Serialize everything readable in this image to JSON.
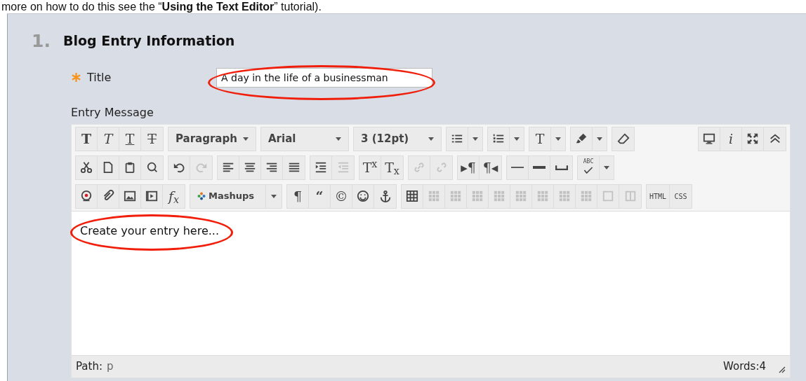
{
  "intro_text": "more on how to do this see the “**Using the Text Editor**” tutorial).",
  "section": {
    "number": "1.",
    "title": "Blog Entry Information"
  },
  "title_field": {
    "label": "Title",
    "required": true,
    "value": "A day in the life of a businessman",
    "circled": true
  },
  "message_label": "Entry Message",
  "toolbar": [
    {
      "groups": [
        {
          "items": [
            {
              "kind": "bold",
              "label": "T",
              "disabled": false
            },
            {
              "kind": "italic",
              "label": "T",
              "disabled": false
            },
            {
              "kind": "underline",
              "label": "T",
              "disabled": false
            },
            {
              "kind": "strike",
              "label": "T",
              "disabled": false
            }
          ]
        },
        {
          "items": [
            {
              "kind": "select",
              "value": "Paragraph",
              "disabled": false
            }
          ]
        },
        {
          "items": [
            {
              "kind": "select",
              "value": "Arial",
              "disabled": false
            }
          ]
        },
        {
          "items": [
            {
              "kind": "select",
              "value": "3 (12pt)",
              "disabled": false
            }
          ]
        },
        {
          "items": [
            {
              "kind": "iconmenu",
              "disabled": false
            }
          ]
        },
        {
          "items": [
            {
              "kind": "iconmenu",
              "disabled": false
            }
          ]
        },
        {
          "items": [
            {
              "kind": "textmenu",
              "label": "T",
              "disabled": false
            }
          ]
        },
        {
          "items": [
            {
              "kind": "iconmenu",
              "disabled": false
            }
          ]
        },
        {
          "items": [
            {
              "kind": "icon",
              "disabled": false
            }
          ]
        }
      ],
      "end_groups": [
        {
          "items": [
            {
              "kind": "icon",
              "disabled": false
            },
            {
              "kind": "italic",
              "label": "i",
              "disabled": false
            },
            {
              "kind": "icon",
              "disabled": false
            },
            {
              "kind": "icon",
              "disabled": false
            }
          ]
        }
      ]
    },
    {
      "groups": [
        {
          "items": [
            {
              "kind": "icon",
              "disabled": false
            },
            {
              "kind": "icon",
              "disabled": false
            },
            {
              "kind": "icon",
              "disabled": false
            },
            {
              "kind": "icon",
              "disabled": false
            }
          ]
        },
        {
          "items": [
            {
              "kind": "icon",
              "disabled": false
            },
            {
              "kind": "icon",
              "disabled": true
            }
          ]
        },
        {
          "items": [
            {
              "kind": "icon",
              "disabled": false
            },
            {
              "kind": "icon",
              "disabled": false
            },
            {
              "kind": "icon",
              "disabled": false
            },
            {
              "kind": "icon",
              "disabled": false
            }
          ]
        },
        {
          "items": [
            {
              "kind": "icon",
              "disabled": false
            },
            {
              "kind": "icon",
              "disabled": true
            }
          ]
        },
        {
          "items": [
            {
              "kind": "text",
              "label": "T$^{x}$",
              "disabled": false
            },
            {
              "kind": "text",
              "label": "T$_{x}$",
              "disabled": false
            }
          ]
        },
        {
          "items": [
            {
              "kind": "icon",
              "disabled": true
            },
            {
              "kind": "icon",
              "disabled": true
            }
          ]
        },
        {
          "items": [
            {
              "kind": "text",
              "label": "▸¶",
              "disabled": false
            },
            {
              "kind": "text",
              "label": "¶◂",
              "disabled": false
            }
          ]
        },
        {
          "items": [
            {
              "kind": "icon",
              "disabled": false
            },
            {
              "kind": "icon",
              "disabled": false
            },
            {
              "kind": "icon",
              "disabled": false
            }
          ]
        },
        {
          "items": [
            {
              "kind": "badgemenu",
              "label": "ABC",
              "disabled": false
            }
          ]
        }
      ]
    },
    {
      "groups": [
        {
          "items": [
            {
              "kind": "icon",
              "disabled": false
            },
            {
              "kind": "icon",
              "disabled": false
            },
            {
              "kind": "icon",
              "disabled": false
            },
            {
              "kind": "icon",
              "disabled": false
            },
            {
              "kind": "italic",
              "label": "f$_{x}$",
              "disabled": false
            }
          ]
        },
        {
          "items": [
            {
              "kind": "menu",
              "value": "Mashups",
              "disabled": false
            }
          ]
        },
        {
          "items": [
            {
              "kind": "text",
              "label": "¶",
              "disabled": false
            },
            {
              "kind": "bold",
              "label": "“",
              "disabled": false
            },
            {
              "kind": "text",
              "label": "©",
              "disabled": false
            },
            {
              "kind": "icon",
              "disabled": false
            },
            {
              "kind": "icon",
              "disabled": false
            }
          ]
        },
        {
          "items": [
            {
              "kind": "icon",
              "disabled": false
            },
            {
              "kind": "icon",
              "disabled": true
            },
            {
              "kind": "icon",
              "disabled": true
            },
            {
              "kind": "icon",
              "disabled": true
            },
            {
              "kind": "icon",
              "disabled": true
            },
            {
              "kind": "icon",
              "disabled": true
            },
            {
              "kind": "icon",
              "disabled": true
            },
            {
              "kind": "icon",
              "disabled": true
            },
            {
              "kind": "icon",
              "disabled": true
            },
            {
              "kind": "icon",
              "disabled": true
            },
            {
              "kind": "icon",
              "disabled": true
            }
          ]
        },
        {
          "items": [
            {
              "kind": "small",
              "label": "HTML",
              "disabled": false
            },
            {
              "kind": "small",
              "label": "CSS",
              "disabled": false
            }
          ]
        }
      ]
    }
  ],
  "body": {
    "text": "Create your entry here...",
    "circled": true
  },
  "status_bar": {
    "path_label": "Path:",
    "path": "p",
    "words": "Words:4"
  }
}
